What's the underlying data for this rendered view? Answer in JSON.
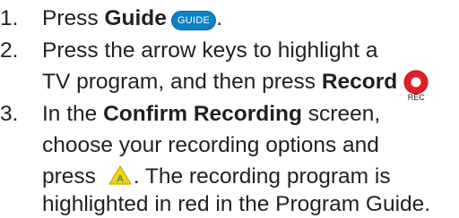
{
  "steps": [
    {
      "number": "1.",
      "before": "Press ",
      "bold": "Guide",
      "button_icon": "guide-button-icon",
      "button_label": "GUIDE",
      "after": "."
    },
    {
      "number": "2.",
      "line1": "Press the arrow keys to highlight a",
      "line2_before": "TV program, and then press ",
      "bold": "Record",
      "button_icon": "record-button-icon",
      "button_label": "REC",
      "after": "."
    },
    {
      "number": "3.",
      "line1_before": "In the ",
      "bold": "Confirm Recording",
      "line1_after": " screen,",
      "line2": "choose your recording options and",
      "line3_before": "press ",
      "button_icon": "a-button-icon",
      "button_label": "A",
      "line3_after": ". The recording program is",
      "line4": "highlighted in red in the Program Guide."
    }
  ],
  "colors": {
    "text": "#231f20",
    "guide_button": "#0a82c8",
    "record_button": "#e31e24",
    "a_button": "#f5d40f"
  }
}
